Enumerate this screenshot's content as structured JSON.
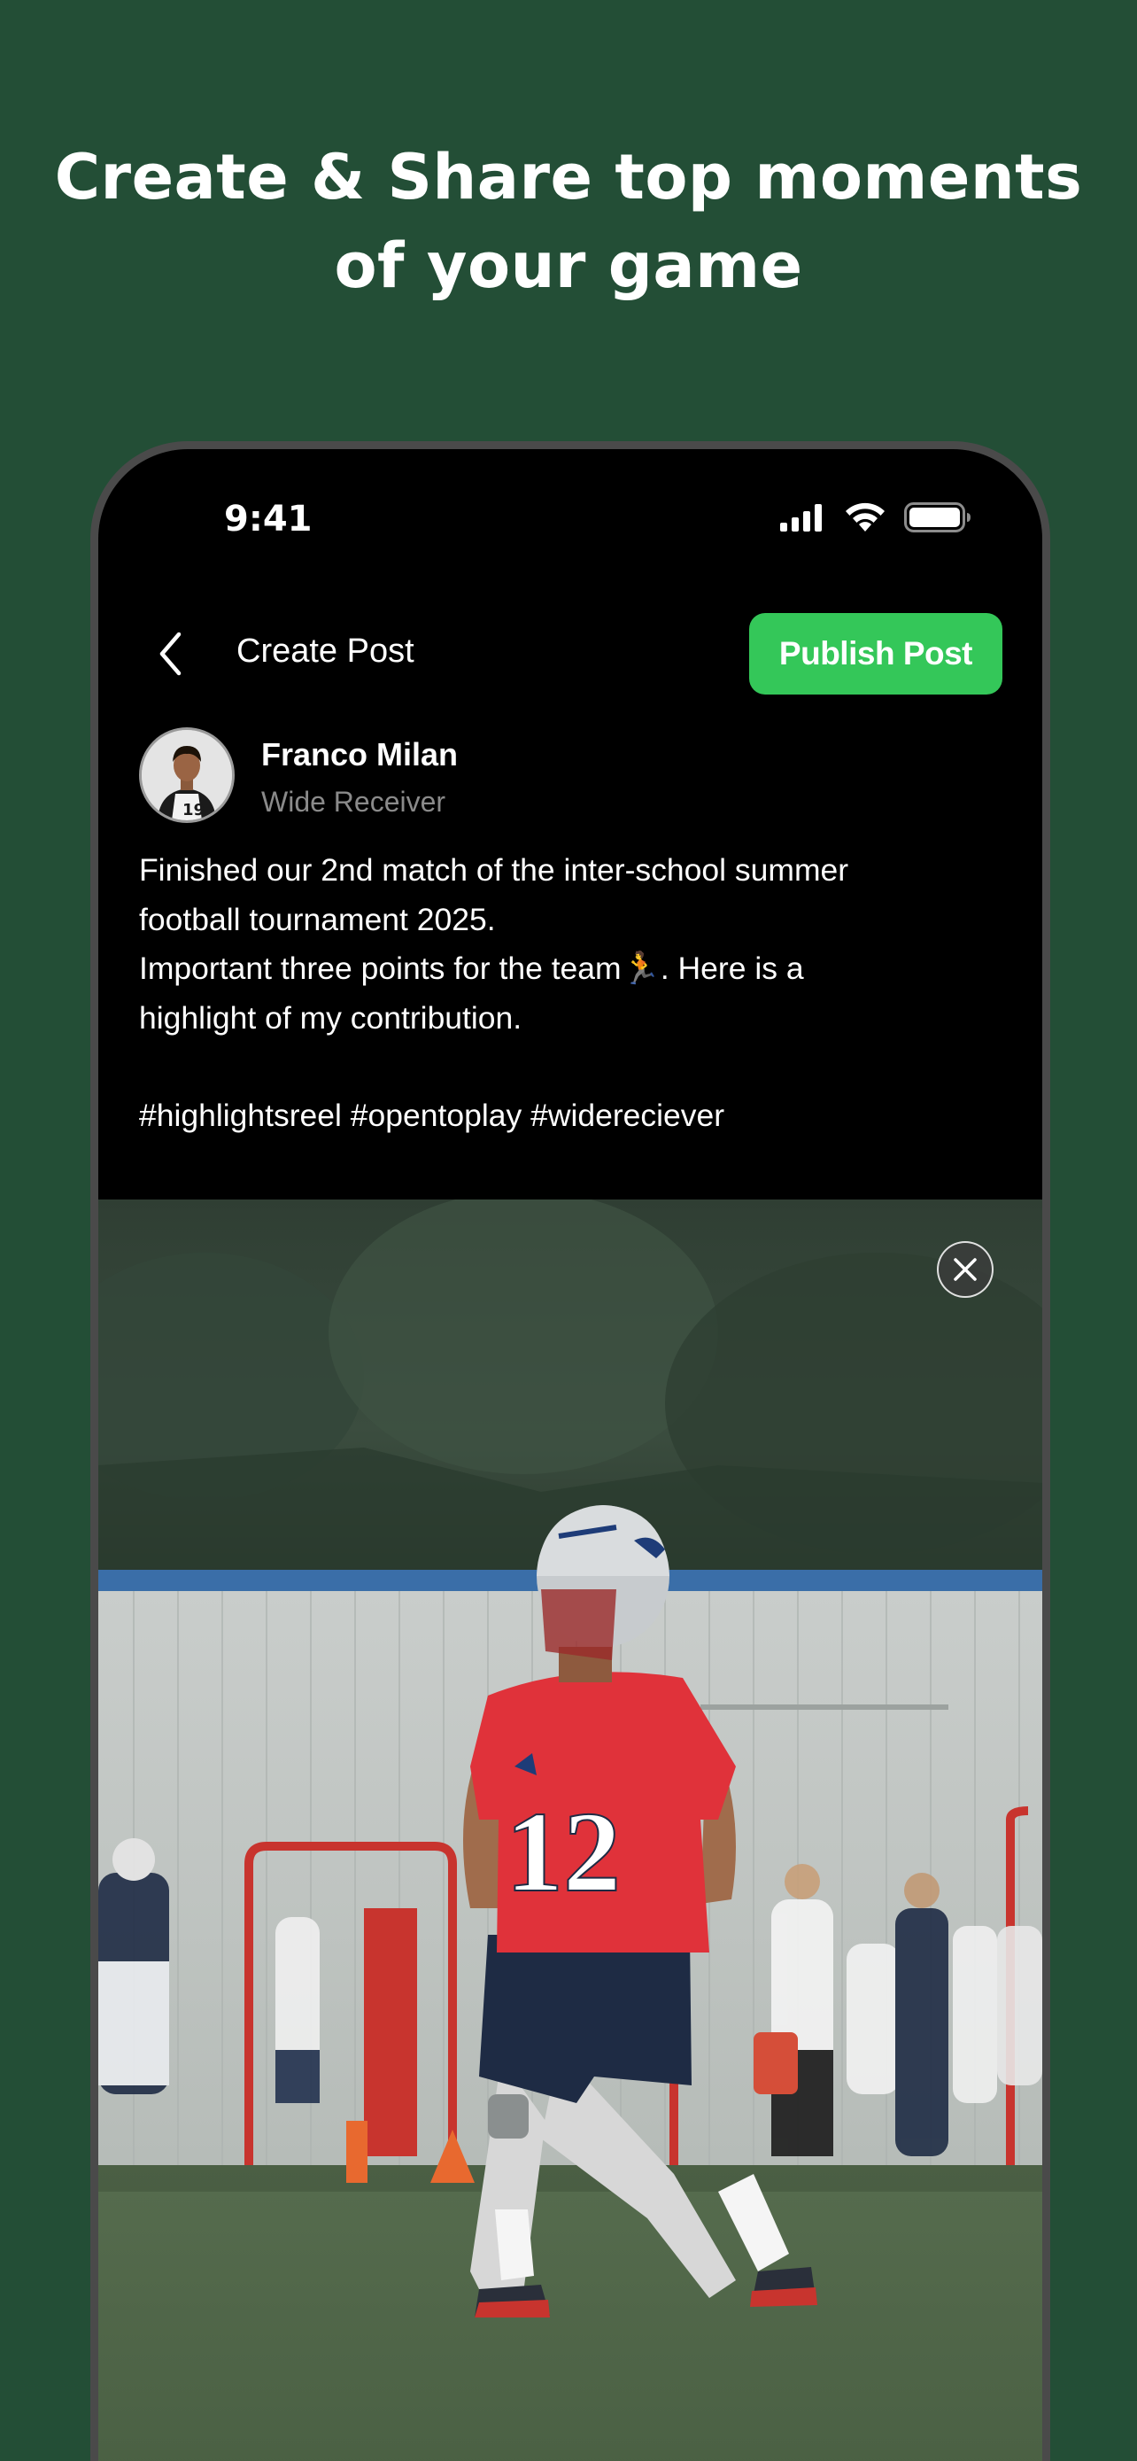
{
  "headline": {
    "line1": "Create & Share top moments",
    "line2": "of your game"
  },
  "status_bar": {
    "time": "9:41",
    "icons": [
      "cellular-signal-icon",
      "wifi-icon",
      "battery-icon"
    ]
  },
  "nav": {
    "back_icon": "chevron-left-icon",
    "title": "Create Post",
    "publish_label": "Publish Post"
  },
  "author": {
    "name": "Franco Milan",
    "role": "Wide Receiver"
  },
  "post": {
    "line1": "Finished our 2nd match of the inter-school summer",
    "line2": "football tournament 2025.",
    "line3": "Important three points for the team🏃. Here is a",
    "line4": "highlight of my contribution.",
    "hashtags": "#highlightsreel #opentoplay #widereciever"
  },
  "media": {
    "close_icon": "close-icon",
    "jersey_number": "12"
  },
  "colors": {
    "background": "#234e36",
    "accent": "#34c759",
    "screen": "#000000",
    "jersey": "#e0323a"
  }
}
